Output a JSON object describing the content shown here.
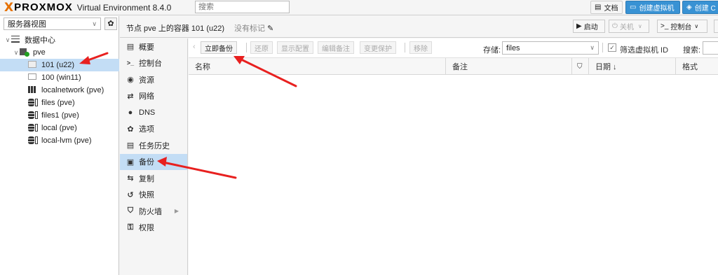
{
  "topbar": {
    "logo_x": "X",
    "logo_text": "PROXMOX",
    "product": "Virtual Environment 8.4.0",
    "search_placeholder": "搜索",
    "docs_label": "文档",
    "create_vm_label": "创建虚拟机",
    "create_ct_label": "创建 C"
  },
  "sidebar": {
    "view_label": "服务器视图",
    "tree": [
      {
        "label": "数据中心",
        "icon": "datacenter-icon",
        "indent": 0,
        "twisty": "∨"
      },
      {
        "label": "pve",
        "icon": "node-online-icon",
        "indent": 1,
        "twisty": "∨"
      },
      {
        "label": "101 (u22)",
        "icon": "container-icon",
        "indent": 2,
        "twisty": "",
        "selected": true
      },
      {
        "label": "100 (win11)",
        "icon": "vm-monitor-icon",
        "indent": 2,
        "twisty": ""
      },
      {
        "label": "localnetwork (pve)",
        "icon": "network-grid-icon",
        "indent": 2,
        "twisty": ""
      },
      {
        "label": "files (pve)",
        "icon": "storage-icon",
        "indent": 2,
        "twisty": ""
      },
      {
        "label": "files1 (pve)",
        "icon": "storage-icon",
        "indent": 2,
        "twisty": ""
      },
      {
        "label": "local (pve)",
        "icon": "storage-icon",
        "indent": 2,
        "twisty": ""
      },
      {
        "label": "local-lvm (pve)",
        "icon": "storage-icon",
        "indent": 2,
        "twisty": ""
      }
    ]
  },
  "content": {
    "title": "节点 pve 上的容器 101 (u22)",
    "tag_label": "没有标记",
    "start_label": "启动",
    "shutdown_label": "关机",
    "console_label": "控制台"
  },
  "nav": [
    {
      "label": "概要",
      "icon": "book-icon"
    },
    {
      "label": "控制台",
      "icon": "terminal-icon"
    },
    {
      "label": "资源",
      "icon": "cube-icon"
    },
    {
      "label": "网络",
      "icon": "exchange-icon"
    },
    {
      "label": "DNS",
      "icon": "globe-icon"
    },
    {
      "label": "选项",
      "icon": "gear-icon"
    },
    {
      "label": "任务历史",
      "icon": "list-icon"
    },
    {
      "label": "备份",
      "icon": "floppy-icon",
      "selected": true
    },
    {
      "label": "复制",
      "icon": "retweet-icon"
    },
    {
      "label": "快照",
      "icon": "history-icon"
    },
    {
      "label": "防火墙",
      "icon": "shield-icon",
      "has_submenu": true
    },
    {
      "label": "权限",
      "icon": "unlock-icon"
    }
  ],
  "backup": {
    "backup_now": "立即备份",
    "restore": "还原",
    "show_config": "显示配置",
    "edit_notes": "编辑备注",
    "change_protection": "变更保护",
    "remove": "移除",
    "storage_label": "存储:",
    "storage_value": "files",
    "filter_label": "筛选虚拟机 ID",
    "search_label": "搜索:",
    "columns": [
      "名称",
      "备注",
      "",
      "日期 ↓",
      "格式"
    ]
  },
  "colors": {
    "accent_blue": "#3892d4",
    "selection": "#c3ddf5",
    "logo_orange": "#e57000",
    "annotation_red": "#e8201f"
  }
}
